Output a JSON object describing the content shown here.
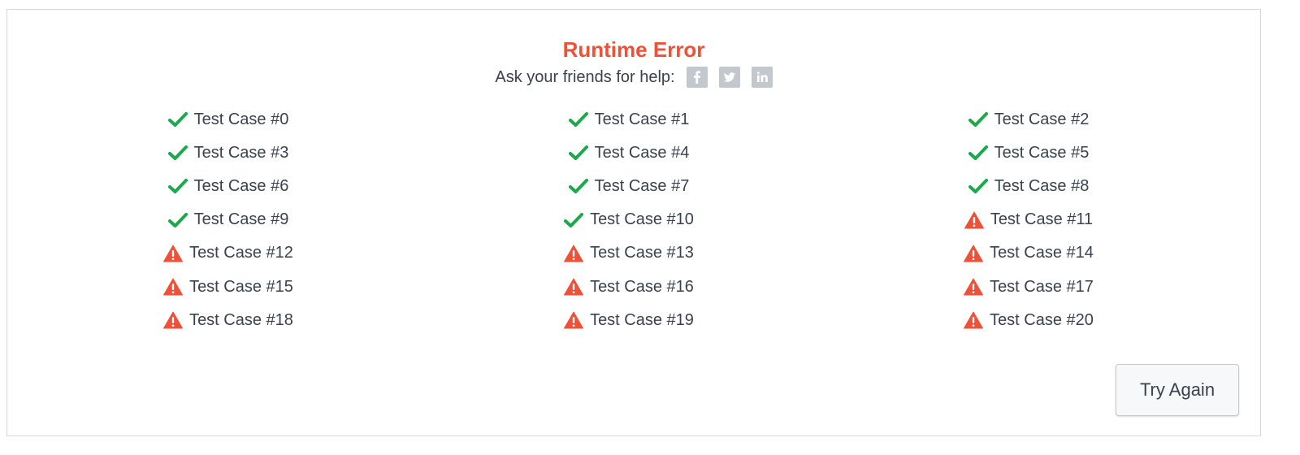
{
  "title": "Runtime Error",
  "share": {
    "label": "Ask your friends for help:",
    "networks": [
      "facebook-icon",
      "twitter-icon",
      "linkedin-icon"
    ]
  },
  "colors": {
    "title": "#ef5138",
    "pass": "#1ba94c",
    "fail": "#ef5138",
    "social": "#c3c8ce"
  },
  "test_cases": [
    {
      "label": "Test Case #0",
      "status": "pass"
    },
    {
      "label": "Test Case #1",
      "status": "pass"
    },
    {
      "label": "Test Case #2",
      "status": "pass"
    },
    {
      "label": "Test Case #3",
      "status": "pass"
    },
    {
      "label": "Test Case #4",
      "status": "pass"
    },
    {
      "label": "Test Case #5",
      "status": "pass"
    },
    {
      "label": "Test Case #6",
      "status": "pass"
    },
    {
      "label": "Test Case #7",
      "status": "pass"
    },
    {
      "label": "Test Case #8",
      "status": "pass"
    },
    {
      "label": "Test Case #9",
      "status": "pass"
    },
    {
      "label": "Test Case #10",
      "status": "pass"
    },
    {
      "label": "Test Case #11",
      "status": "fail"
    },
    {
      "label": "Test Case #12",
      "status": "fail"
    },
    {
      "label": "Test Case #13",
      "status": "fail"
    },
    {
      "label": "Test Case #14",
      "status": "fail"
    },
    {
      "label": "Test Case #15",
      "status": "fail"
    },
    {
      "label": "Test Case #16",
      "status": "fail"
    },
    {
      "label": "Test Case #17",
      "status": "fail"
    },
    {
      "label": "Test Case #18",
      "status": "fail"
    },
    {
      "label": "Test Case #19",
      "status": "fail"
    },
    {
      "label": "Test Case #20",
      "status": "fail"
    }
  ],
  "try_again_label": "Try Again"
}
